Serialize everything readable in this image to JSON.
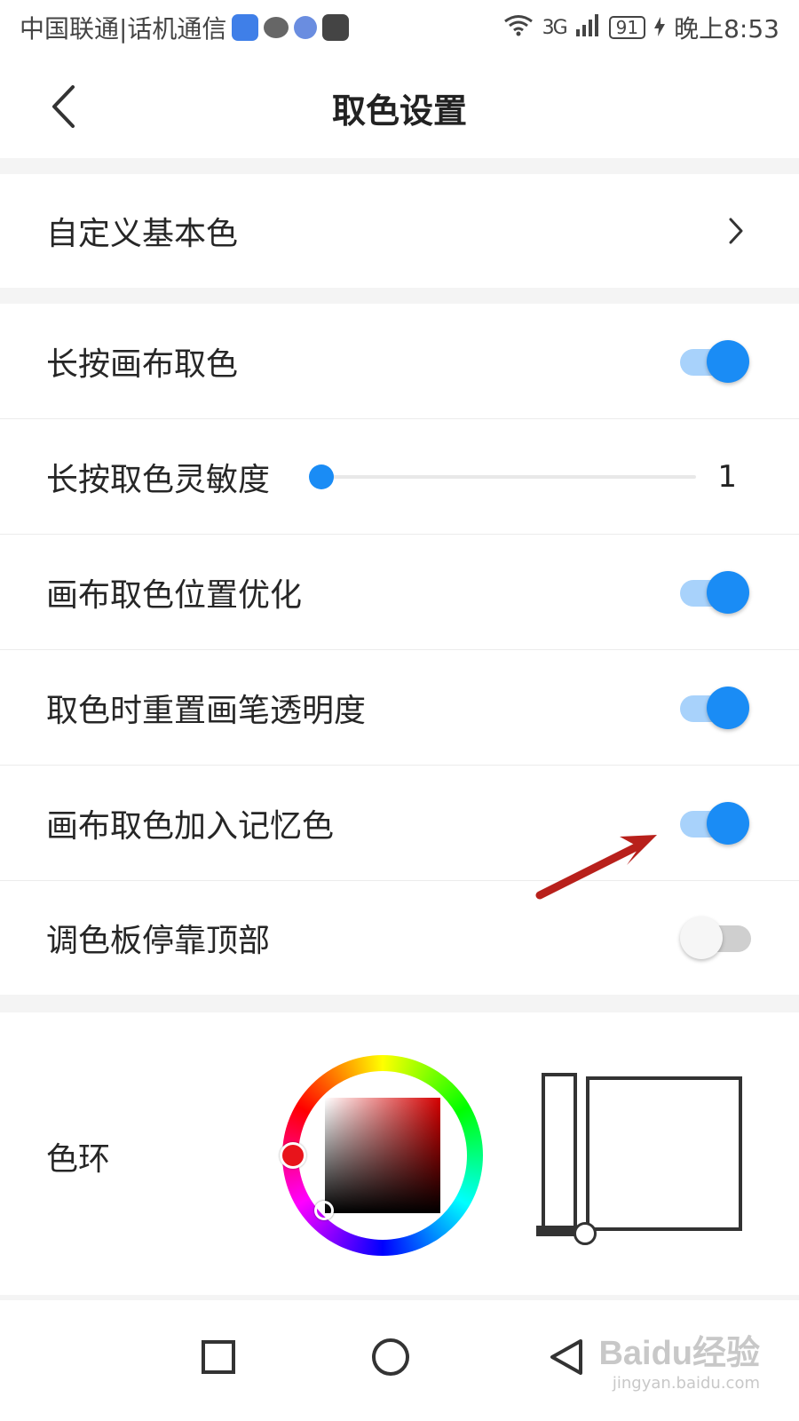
{
  "status_bar": {
    "carrier": "中国联通|话机通信",
    "network": "3G",
    "battery": "91",
    "time": "晚上8:53"
  },
  "header": {
    "title": "取色设置"
  },
  "settings": {
    "custom_colors": {
      "label": "自定义基本色"
    },
    "long_press_pick": {
      "label": "长按画布取色",
      "enabled": true
    },
    "sensitivity": {
      "label": "长按取色灵敏度",
      "value": "1",
      "level": 0
    },
    "position_opt": {
      "label": "画布取色位置优化",
      "enabled": true
    },
    "reset_opacity": {
      "label": "取色时重置画笔透明度",
      "enabled": true
    },
    "add_memory": {
      "label": "画布取色加入记忆色",
      "enabled": true
    },
    "palette_top": {
      "label": "调色板停靠顶部",
      "enabled": false
    },
    "color_wheel": {
      "label": "色环"
    }
  },
  "colors": {
    "accent": "#1a8cf5",
    "accent_light": "#a8d2fb",
    "annotation_arrow": "#b8201b"
  },
  "watermark": {
    "brand": "Baidu经验",
    "url": "jingyan.baidu.com"
  },
  "icons": {
    "back": "chevron-left-icon",
    "forward": "chevron-right-icon",
    "nav_recent": "square-icon",
    "nav_home": "circle-icon",
    "nav_back": "triangle-left-icon"
  }
}
